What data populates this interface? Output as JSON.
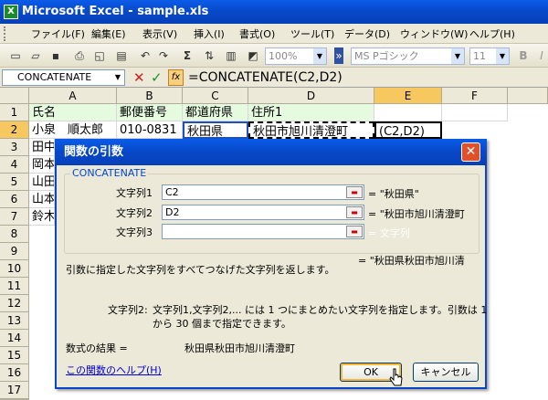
{
  "window": {
    "title": "Microsoft Excel - sample.xls",
    "icon": "excel-icon"
  },
  "menu": [
    "ファイル(F)",
    "編集(E)",
    "表示(V)",
    "挿入(I)",
    "書式(O)",
    "ツール(T)",
    "データ(D)",
    "ウィンドウ(W)",
    "ヘルプ(H)"
  ],
  "toolbar": {
    "zoom": "100%",
    "font": "MS Pゴシック",
    "size": "11",
    "bold": "B",
    "italic": "I"
  },
  "formula_bar": {
    "name_box": "CONCATENATE",
    "formula": "=CONCATENATE(C2,D2)",
    "cancel": "✕",
    "enter": "✓",
    "fx": "fx"
  },
  "sheet": {
    "columns": [
      "A",
      "B",
      "C",
      "D",
      "E",
      "F"
    ],
    "rows": [
      "1",
      "2",
      "3",
      "4",
      "5",
      "6",
      "7",
      "8",
      "9",
      "10",
      "11",
      "12",
      "13",
      "14",
      "15",
      "16",
      "17",
      "18"
    ],
    "cells": {
      "A1": "氏名",
      "B1": "郵便番号",
      "C1": "都道府県",
      "D1": "住所1",
      "A2": "小泉　順太郎",
      "B2": "010-0831",
      "C2": "秋田県",
      "D2": "秋田市旭川清澄町",
      "E2": "(C2,D2)",
      "A3": "田中",
      "A4": "岡本",
      "A5": "山田",
      "A6": "山本",
      "A7": "鈴木"
    }
  },
  "dialog": {
    "title": "関数の引数",
    "function_name": "CONCATENATE",
    "args": [
      {
        "label": "文字列1",
        "value": "C2",
        "result": "= \"秋田県\""
      },
      {
        "label": "文字列2",
        "value": "D2",
        "result": "= \"秋田市旭川清澄町"
      },
      {
        "label": "文字列3",
        "value": "",
        "result": "= 文字列"
      }
    ],
    "total_result": "= \"秋田県秋田市旭川清",
    "description": "引数に指定した文字列をすべてつなげた文字列を返します。",
    "arg_help_label": "文字列2:",
    "arg_help_line1": "文字列1,文字列2,... には 1 つにまとめたい文字列を指定します。引数は 1",
    "arg_help_line2": "から 30 個まで指定できます。",
    "formula_result_label": "数式の結果 =",
    "formula_result_value": "秋田県秋田市旭川清澄町",
    "help_link": "この関数のヘルプ(H)",
    "ok": "OK",
    "cancel": "キャンセル",
    "close": "✕"
  }
}
